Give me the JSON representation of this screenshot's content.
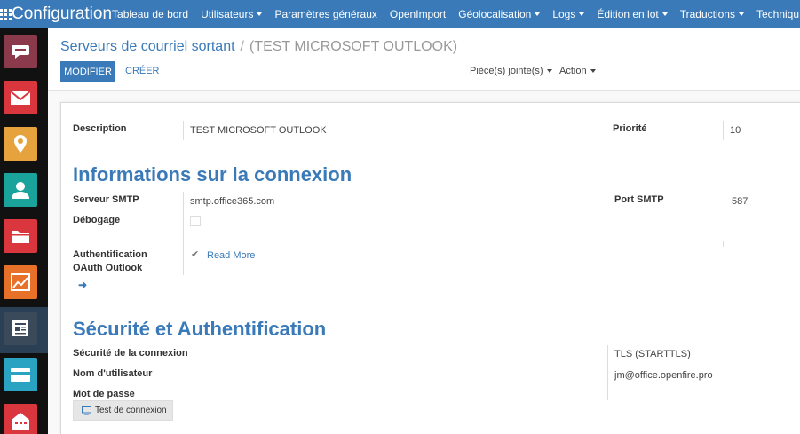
{
  "app": {
    "title": "Configuration"
  },
  "menu": [
    {
      "label": "Tableau de bord",
      "caret": false
    },
    {
      "label": "Utilisateurs",
      "caret": true
    },
    {
      "label": "Paramètres généraux",
      "caret": false
    },
    {
      "label": "OpenImport",
      "caret": false
    },
    {
      "label": "Géolocalisation",
      "caret": true
    },
    {
      "label": "Logs",
      "caret": true
    },
    {
      "label": "Édition en lot",
      "caret": true
    },
    {
      "label": "Traductions",
      "caret": true
    },
    {
      "label": "Techniqu",
      "caret": false
    }
  ],
  "sidebar": [
    {
      "name": "discuss-icon",
      "color": "#8b3a4b"
    },
    {
      "name": "mail-icon",
      "color": "#d9363e"
    },
    {
      "name": "map-pin-icon",
      "color": "#e6a23c"
    },
    {
      "name": "contacts-icon",
      "color": "#1aa39a"
    },
    {
      "name": "folder-icon",
      "color": "#d9363e"
    },
    {
      "name": "chart-icon",
      "color": "#e8712a"
    },
    {
      "name": "document-icon",
      "color": "#3b4a5a"
    },
    {
      "name": "card-icon",
      "color": "#2aa3c2"
    },
    {
      "name": "building-icon",
      "color": "#d9363e"
    }
  ],
  "breadcrumb": {
    "parent": "Serveurs de courriel sortant",
    "separator": "/",
    "current": "(TEST MICROSOFT OUTLOOK)"
  },
  "toolbar": {
    "edit_label": "MODIFIER",
    "create_label": "CRÉER",
    "attachments_label": "Pièce(s) jointe(s)",
    "action_label": "Action"
  },
  "form": {
    "description_label": "Description",
    "description_value": "TEST MICROSOFT OUTLOOK",
    "priority_label": "Priorité",
    "priority_value": "10",
    "connection_title": "Informations sur la connexion",
    "smtp_server_label": "Serveur SMTP",
    "smtp_server_value": "smtp.office365.com",
    "smtp_port_label": "Port SMTP",
    "smtp_port_value": "587",
    "debug_label": "Débogage",
    "oauth_label_1": "Authentification",
    "oauth_label_2": "OAuth Outlook",
    "read_more": "Read More",
    "security_title": "Sécurité et Authentification",
    "connection_security_label": "Sécurité de la connexion",
    "connection_security_value": "TLS (STARTTLS)",
    "username_label": "Nom d'utilisateur",
    "username_value": "jm@office.openfire.pro",
    "password_label": "Mot de passe",
    "test_button": "Test de connexion"
  },
  "colors": {
    "primary": "#3a7ab8"
  }
}
